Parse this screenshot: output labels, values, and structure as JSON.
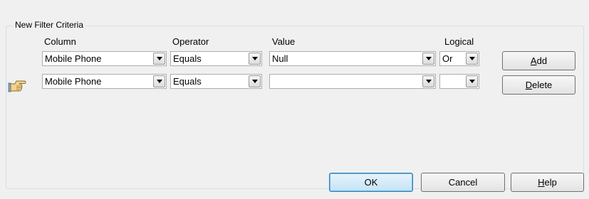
{
  "group": {
    "legend": "New Filter Criteria"
  },
  "headers": {
    "column": "Column",
    "operator": "Operator",
    "value": "Value",
    "logical": "Logical"
  },
  "rows": [
    {
      "column": "Mobile Phone",
      "operator": "Equals",
      "value": "Null",
      "logical": "Or"
    },
    {
      "column": "Mobile Phone",
      "operator": "Equals",
      "value": "",
      "logical": ""
    }
  ],
  "buttons": {
    "add": {
      "accel": "A",
      "rest": "dd"
    },
    "delete": {
      "accel": "D",
      "rest": "elete"
    },
    "ok": "OK",
    "cancel": "Cancel",
    "help": {
      "accel": "H",
      "rest": "elp"
    }
  },
  "icons": {
    "row_pointer": "pointing-hand-icon"
  }
}
